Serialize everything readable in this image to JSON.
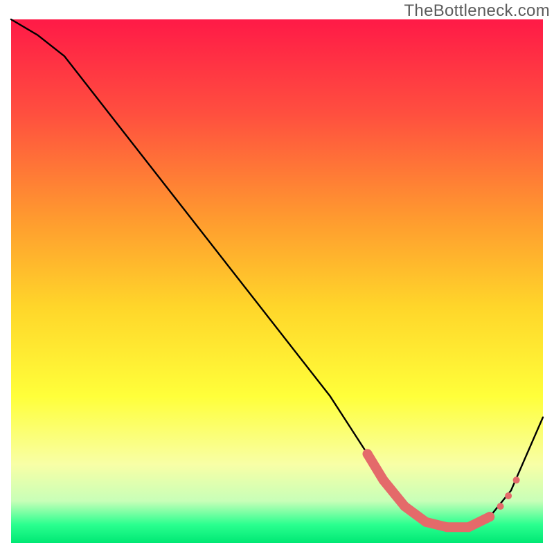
{
  "watermark": "TheBottleneck.com",
  "chart_data": {
    "type": "line",
    "title": "",
    "xlabel": "",
    "ylabel": "",
    "xlim": [
      0,
      100
    ],
    "ylim": [
      0,
      100
    ],
    "gradient_stops": [
      {
        "offset": 0.0,
        "color": "#ff1a47"
      },
      {
        "offset": 0.18,
        "color": "#ff4f3f"
      },
      {
        "offset": 0.38,
        "color": "#ff9a2f"
      },
      {
        "offset": 0.55,
        "color": "#ffd62a"
      },
      {
        "offset": 0.72,
        "color": "#ffff3a"
      },
      {
        "offset": 0.85,
        "color": "#f8ffa6"
      },
      {
        "offset": 0.92,
        "color": "#c8ffb8"
      },
      {
        "offset": 0.965,
        "color": "#2bff8f"
      },
      {
        "offset": 1.0,
        "color": "#00e874"
      }
    ],
    "series": [
      {
        "name": "bottleneck-curve",
        "x": [
          0,
          5,
          10,
          20,
          30,
          40,
          50,
          60,
          67,
          70,
          74,
          78,
          82,
          86,
          90,
          94,
          100
        ],
        "y": [
          100,
          97,
          93,
          80,
          67,
          54,
          41,
          28,
          17,
          12,
          7,
          4,
          3,
          3,
          5,
          10,
          24
        ]
      }
    ],
    "highlight_band": {
      "name": "optimal-range",
      "x": [
        67,
        70,
        74,
        78,
        82,
        86,
        90
      ],
      "y": [
        17,
        12,
        7,
        4,
        3,
        3,
        5
      ],
      "color": "#e46a6a",
      "radius": 7
    },
    "side_dots": {
      "x": [
        92,
        93.5,
        95
      ],
      "y": [
        7,
        9,
        12
      ],
      "color": "#e46a6a",
      "radius": 5
    }
  }
}
